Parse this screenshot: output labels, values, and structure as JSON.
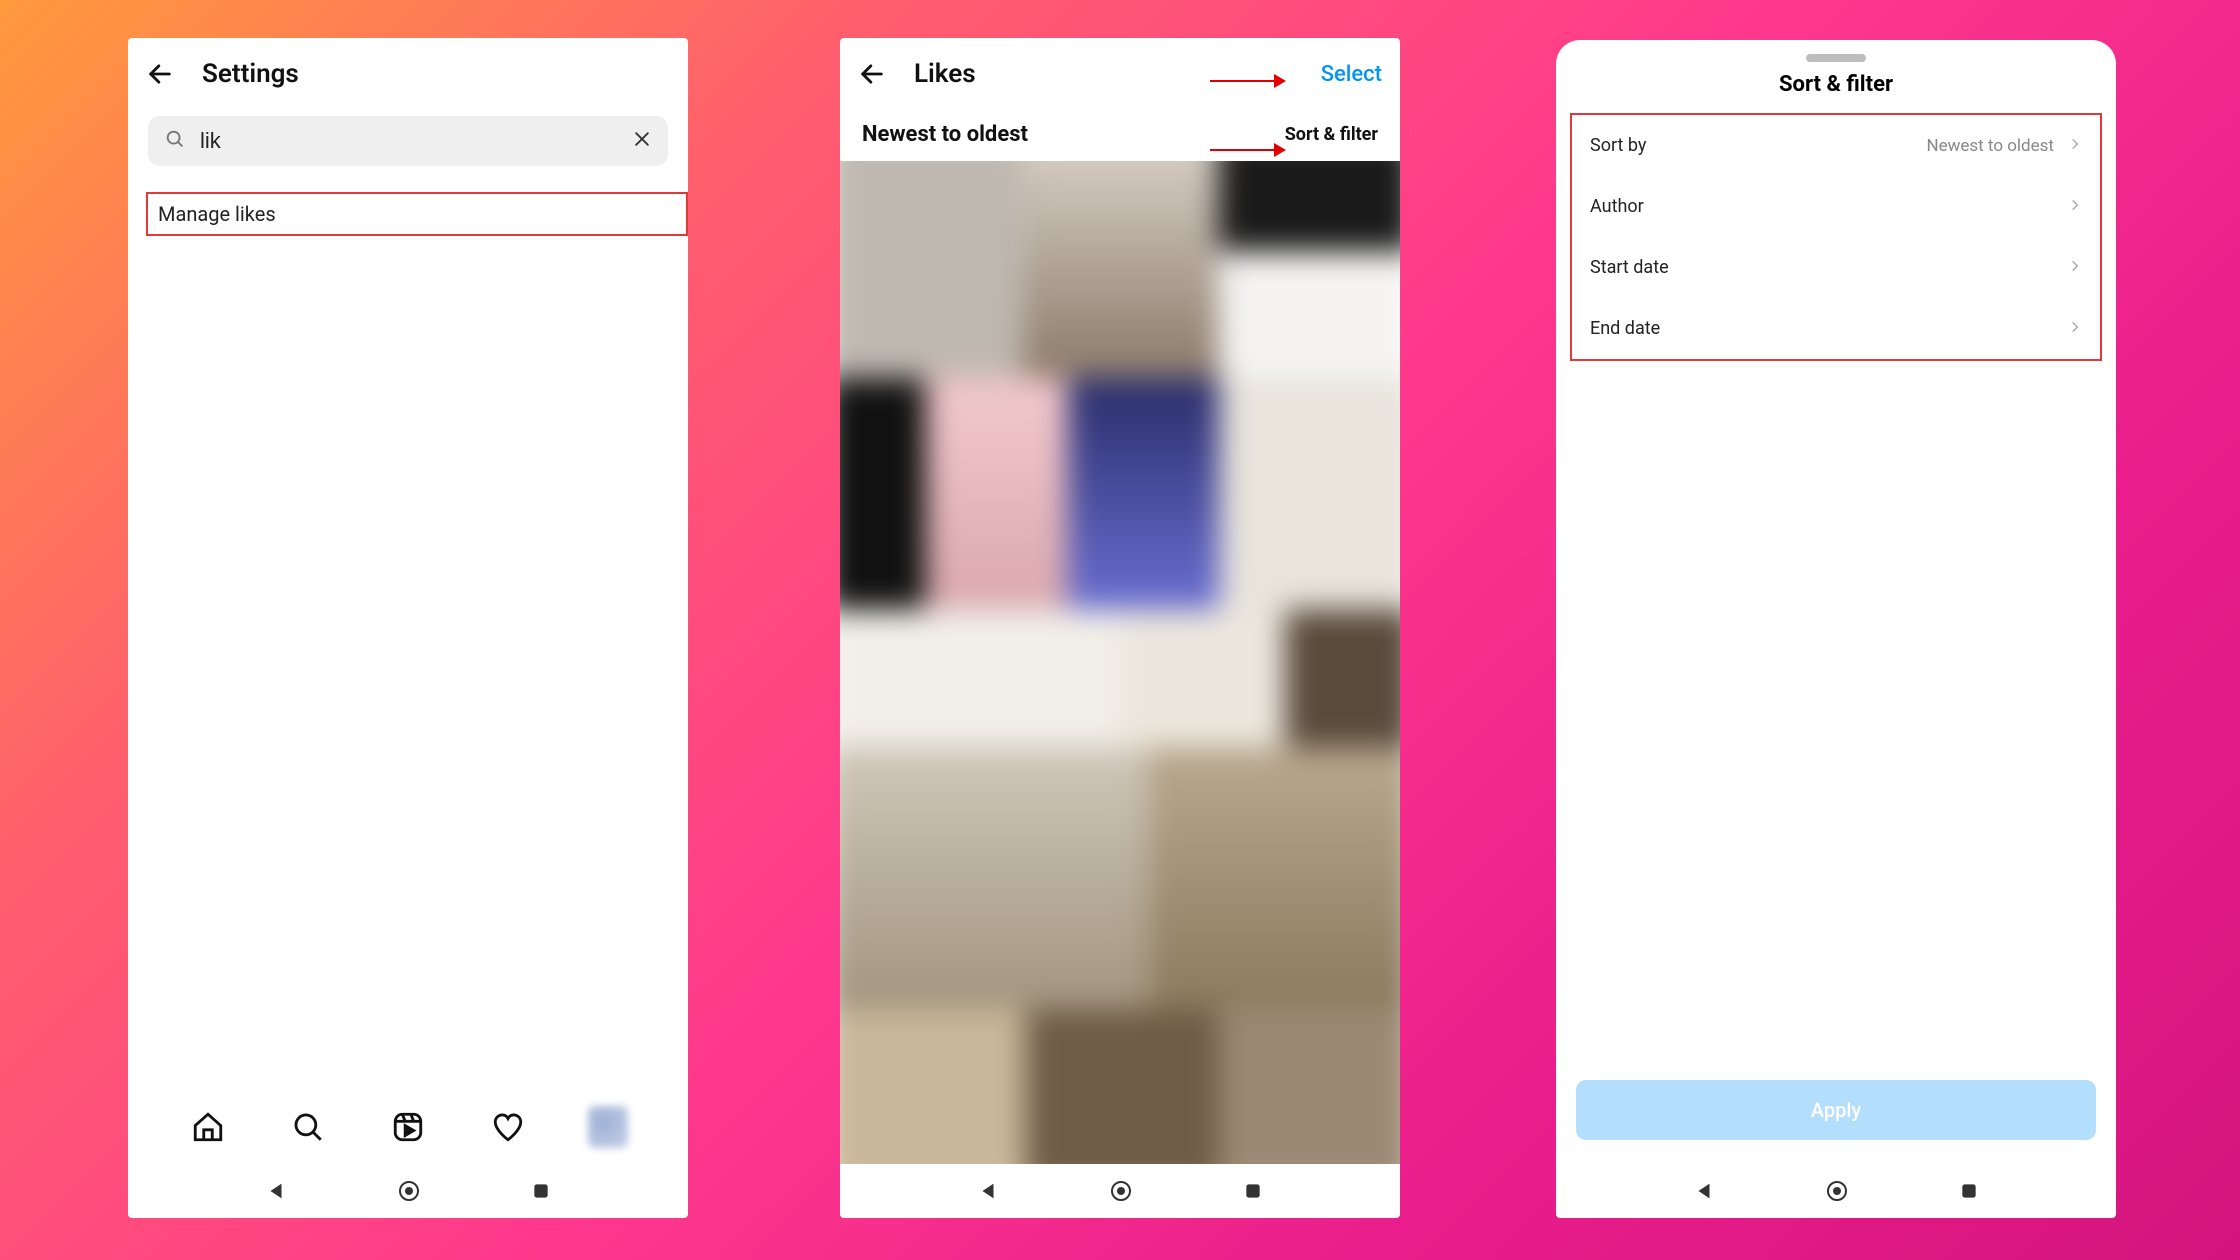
{
  "screens": {
    "settings": {
      "title": "Settings",
      "search_value": "lik",
      "result": "Manage likes"
    },
    "likes": {
      "title": "Likes",
      "select_label": "Select",
      "sort_label": "Newest to oldest",
      "sort_filter_link": "Sort & filter"
    },
    "filter": {
      "title": "Sort & filter",
      "rows": {
        "sort_by": {
          "label": "Sort by",
          "value": "Newest to oldest"
        },
        "author": {
          "label": "Author"
        },
        "start_date": {
          "label": "Start date"
        },
        "end_date": {
          "label": "End date"
        }
      },
      "apply_label": "Apply"
    }
  }
}
